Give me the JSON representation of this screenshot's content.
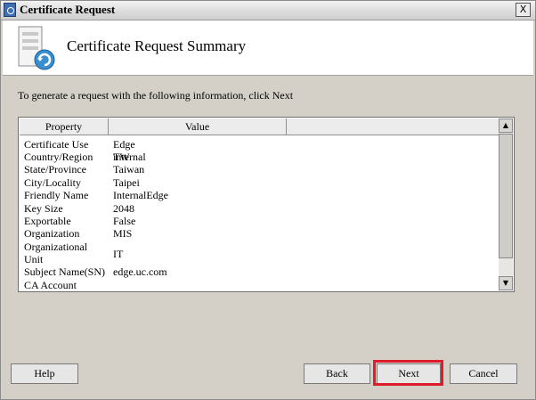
{
  "window": {
    "title": "Certificate Request",
    "close_glyph": "X"
  },
  "header": {
    "title": "Certificate Request Summary",
    "icon": "certificate-request-icon"
  },
  "instruction": "To generate a request with the following information, click Next",
  "table": {
    "columns": [
      "Property",
      "Value",
      ""
    ],
    "rows": [
      {
        "property": "Certificate Use",
        "value": "Edge internal"
      },
      {
        "property": "Country/Region",
        "value": "TW"
      },
      {
        "property": "State/Province",
        "value": "Taiwan"
      },
      {
        "property": "City/Locality",
        "value": "Taipei"
      },
      {
        "property": "Friendly Name",
        "value": "InternalEdge"
      },
      {
        "property": "Key Size",
        "value": "2048"
      },
      {
        "property": "Exportable",
        "value": "False"
      },
      {
        "property": "Organization",
        "value": "MIS"
      },
      {
        "property": "Organizational Unit",
        "value": "IT"
      },
      {
        "property": "Subject Name(SN)",
        "value": "edge.uc.com"
      },
      {
        "property": "CA Account",
        "value": ""
      }
    ]
  },
  "buttons": {
    "help": "Help",
    "back": "Back",
    "next": "Next",
    "cancel": "Cancel"
  },
  "colors": {
    "highlight": "#e01b2a",
    "dialog_bg": "#d4d0c8"
  }
}
